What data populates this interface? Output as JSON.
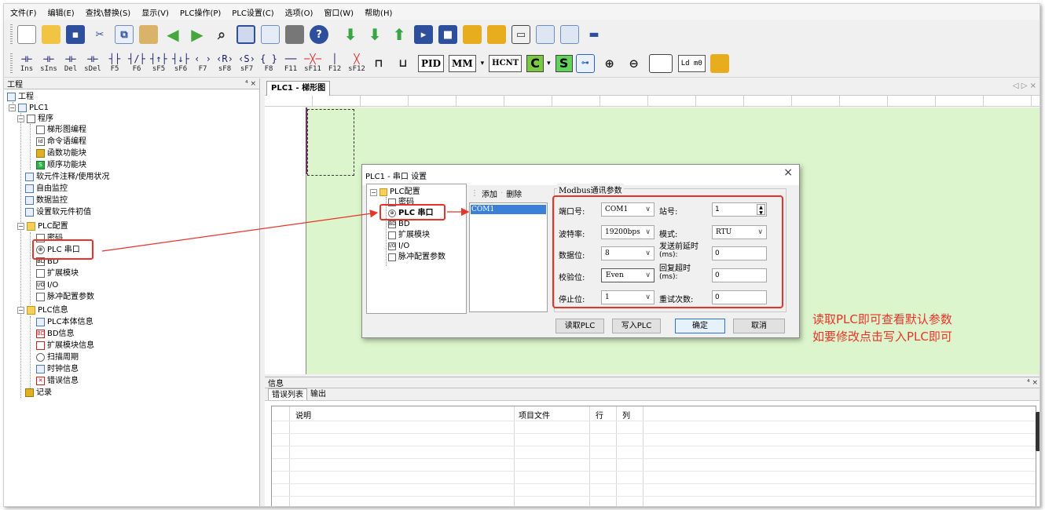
{
  "menu": [
    "文件(F)",
    "编辑(E)",
    "查找\\替换(S)",
    "显示(V)",
    "PLC操作(P)",
    "PLC设置(C)",
    "选项(O)",
    "窗口(W)",
    "帮助(H)"
  ],
  "toolbar2": [
    {
      "sym": "⊣⊢",
      "label": "Ins"
    },
    {
      "sym": "⊣⊢",
      "label": "sIns"
    },
    {
      "sym": "⊣⊢",
      "label": "Del"
    },
    {
      "sym": "⊣⊢",
      "label": "sDel"
    },
    {
      "sym": "┤├",
      "label": "F5"
    },
    {
      "sym": "┤/├",
      "label": "F6"
    },
    {
      "sym": "┤↑├",
      "label": "sF5"
    },
    {
      "sym": "┤↓├",
      "label": "sF6"
    },
    {
      "sym": "‹ ›",
      "label": "F7"
    },
    {
      "sym": "‹R›",
      "label": "sF8"
    },
    {
      "sym": "‹S›",
      "label": "sF7"
    },
    {
      "sym": "{ }",
      "label": "F8"
    },
    {
      "sym": "──",
      "label": "F11"
    },
    {
      "sym": "─╳─",
      "label": "sF11"
    },
    {
      "sym": "│",
      "label": "F12"
    },
    {
      "sym": "╳",
      "label": "sF12"
    }
  ],
  "toolbar2_boxes": [
    "PID",
    "MM",
    "HCNT"
  ],
  "toolbar2_c": "C",
  "toolbar2_s": "S",
  "toolbar2_ldm0": "Ld m0",
  "left_panel": {
    "title": "工程",
    "pin": "⁴ ×",
    "tree": [
      {
        "label": "工程",
        "level": 0
      },
      {
        "label": "PLC1",
        "level": 1
      },
      {
        "label": "程序",
        "level": 2
      },
      {
        "label": "梯形图编程",
        "level": 3
      },
      {
        "label": "命令语编程",
        "level": 3
      },
      {
        "label": "函数功能块",
        "level": 3
      },
      {
        "label": "顺序功能块",
        "level": 3
      },
      {
        "label": "软元件注释/使用状况",
        "level": 2
      },
      {
        "label": "自由监控",
        "level": 2
      },
      {
        "label": "数据监控",
        "level": 2
      },
      {
        "label": "设置软元件初值",
        "level": 2
      },
      {
        "label": "PLC配置",
        "level": 2
      },
      {
        "label": "密码",
        "level": 3
      },
      {
        "label": "PLC 串口",
        "level": 3
      },
      {
        "label": "BD",
        "level": 3
      },
      {
        "label": "扩展模块",
        "level": 3
      },
      {
        "label": "I/O",
        "level": 3
      },
      {
        "label": "脉冲配置参数",
        "level": 3
      },
      {
        "label": "PLC信息",
        "level": 2
      },
      {
        "label": "PLC本体信息",
        "level": 3
      },
      {
        "label": "BD信息",
        "level": 3
      },
      {
        "label": "扩展模块信息",
        "level": 3
      },
      {
        "label": "扫描周期",
        "level": 3
      },
      {
        "label": "时钟信息",
        "level": 3
      },
      {
        "label": "错误信息",
        "level": 3
      },
      {
        "label": "记录",
        "level": 2
      }
    ]
  },
  "editor": {
    "tab": "PLC1 - 梯形图",
    "tab_controls": "◁ ▷ ×"
  },
  "messages": {
    "title": "信息",
    "pin": "⁴ ×",
    "tabs": [
      "错误列表",
      "输出"
    ],
    "columns": [
      "说明",
      "项目文件",
      "行",
      "列"
    ]
  },
  "dialog": {
    "title": "PLC1 - 串口 设置",
    "close": "×",
    "tree": [
      "PLC配置",
      "密码",
      "PLC 串口",
      "BD",
      "扩展模块",
      "I/O",
      "脉冲配置参数"
    ],
    "add": "添加",
    "delete": "删除",
    "list_items": [
      "COM1"
    ],
    "group_title": "Modbus通讯参数",
    "fields": {
      "port_label": "端口号:",
      "port_value": "COM1",
      "station_label": "站号:",
      "station_value": "1",
      "baud_label": "波特率:",
      "baud_value": "19200bps",
      "mode_label": "模式:",
      "mode_value": "RTU",
      "databits_label": "数据位:",
      "databits_value": "8",
      "pre_delay_label": "发送前延时",
      "pre_delay_unit": "(ms):",
      "pre_delay_value": "0",
      "parity_label": "校验位:",
      "parity_value": "Even",
      "reply_timeout_label": "回复超时",
      "reply_timeout_unit": "(ms):",
      "reply_timeout_value": "0",
      "stopbits_label": "停止位:",
      "stopbits_value": "1",
      "retries_label": "重试次数:",
      "retries_value": "0"
    },
    "buttons": {
      "read": "读取PLC",
      "write": "写入PLC",
      "ok": "确定",
      "cancel": "取消"
    }
  },
  "annotation": {
    "line1": "读取PLC即可查看默认参数",
    "line2": "如要修改点击写入PLC即可",
    "color": "#e8332a"
  }
}
